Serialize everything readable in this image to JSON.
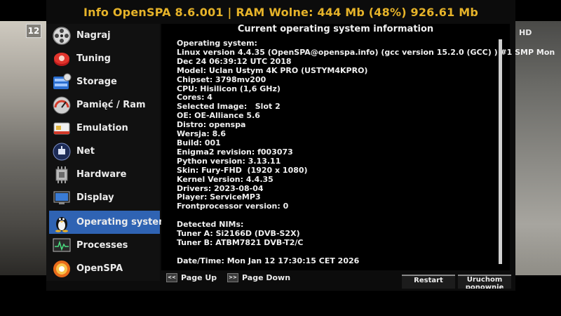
{
  "header": {
    "title": "Info OpenSPA 8.6.001 | RAM Wolne: 444 Mb (48%) 926.61 Mb"
  },
  "background": {
    "channel_number": "12",
    "channel_badge": "HD"
  },
  "sidebar": {
    "items": [
      {
        "label": "Nagraj",
        "icon": "film-reel-icon"
      },
      {
        "label": "Tuning",
        "icon": "tuning-icon"
      },
      {
        "label": "Storage",
        "icon": "storage-icon"
      },
      {
        "label": "Pamięć / Ram",
        "icon": "memory-gauge-icon"
      },
      {
        "label": "Emulation",
        "icon": "smartcard-icon"
      },
      {
        "label": "Net",
        "icon": "network-icon"
      },
      {
        "label": "Hardware",
        "icon": "cpu-chip-icon"
      },
      {
        "label": "Display",
        "icon": "display-icon"
      },
      {
        "label": "Operating system",
        "icon": "penguin-icon",
        "selected": true
      },
      {
        "label": "Processes",
        "icon": "monitor-icon"
      },
      {
        "label": "OpenSPA",
        "icon": "openspa-logo-icon"
      }
    ]
  },
  "content": {
    "title": "Current operating system information",
    "info_text": "Operating system:\nLinux version 4.4.35 (OpenSPA@openspa.info) (gcc version 15.2.0 (GCC) ) #1 SMP Mon\nDec 24 06:39:12 UTC 2018\nModel: Uclan Ustym 4K PRO (USTYM4KPRO)\nChipset: 3798mv200\nCPU: Hisilicon (1,6 GHz)\nCores: 4\nSelected Image:   Slot 2\nOE: OE-Alliance 5.6\nDistro: openspa\nWersja: 8.6\nBuild: 001\nEnigma2 revision: f003073\nPython version: 3.13.11\nSkin: Fury-FHD  (1920 x 1080)\nKernel Version: 4.4.35\nDrivers: 2023-08-04\nPlayer: ServiceMP3\nFrontprocessor version: 0\n\nDetected NIMs:\nTuner A: Si2166D (DVB-S2X)\nTuner B: ATBM7821 DVB-T2/C\n\nDate/Time: Mon Jan 12 17:30:15 CET 2026"
  },
  "footer": {
    "page_up_key": "<<",
    "page_up_label": "Page Up",
    "page_down_key": ">>",
    "page_down_label": "Page Down",
    "restart_label": "Restart",
    "reboot_label": "Uruchom ponownie"
  },
  "colors": {
    "title": "#e6b329",
    "selected": "#2f63b3",
    "panel": "#0c0c0c"
  }
}
